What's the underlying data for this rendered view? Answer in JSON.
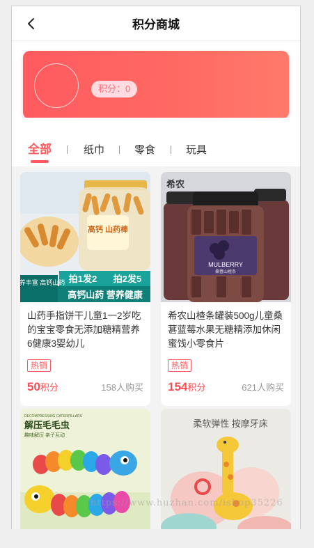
{
  "nav": {
    "title": "积分商城"
  },
  "banner": {
    "points_label": "积分：0"
  },
  "tabs": [
    {
      "label": "全部",
      "active": true
    },
    {
      "label": "纸巾",
      "active": false
    },
    {
      "label": "零食",
      "active": false
    },
    {
      "label": "玩具",
      "active": false
    }
  ],
  "products": [
    {
      "name": "山药手指饼干儿童1一2岁吃的宝宝零食无添加糖精营养6健康3婴幼儿",
      "tag": "热销",
      "price": "50",
      "unit": "积分",
      "sold": "158人购买",
      "img_text": {
        "sticker": "高钙 山药棒",
        "promo1": "拍1发2",
        "promo2": "拍2发5",
        "bottom_left": "营养丰富 高钙山药",
        "bottom_right": "高钙山药 营养健康"
      }
    },
    {
      "name": "希农山楂条罐装500g儿童桑葚蓝莓水果无糖精添加休闲蜜饯小零食片",
      "tag": "热销",
      "price": "154",
      "unit": "积分",
      "sold": "621人购买",
      "img_text": {
        "brand": "希农",
        "label": "MULBERRY",
        "sub": "桑葚山楂条"
      }
    },
    {
      "name": "",
      "img_text": {
        "small": "DECOMPRESSING CATERPILLARS",
        "title": "解压毛毛虫",
        "sub": "趣味解压 亲子互动"
      }
    },
    {
      "name": "",
      "img_text": {
        "title": "柔软弹性 按摩牙床"
      }
    }
  ],
  "watermark": "https://www.huzhan.com/ishop35226"
}
